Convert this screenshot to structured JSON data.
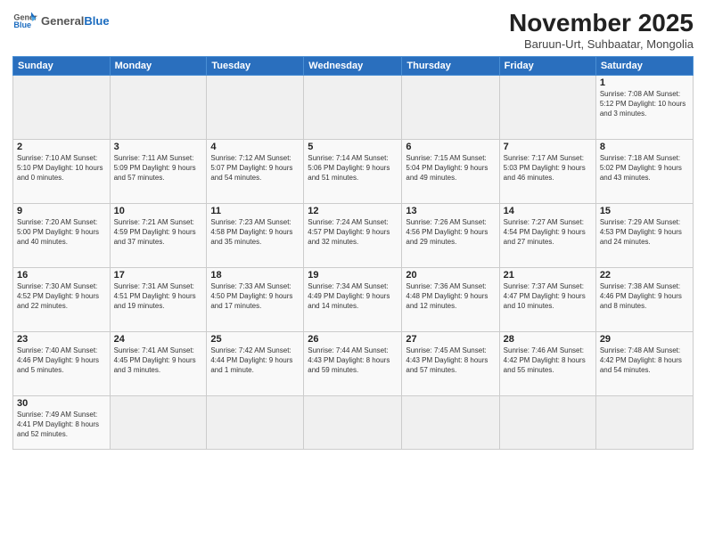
{
  "header": {
    "logo_general": "General",
    "logo_blue": "Blue",
    "month": "November 2025",
    "location": "Baruun-Urt, Suhbaatar, Mongolia"
  },
  "days_of_week": [
    "Sunday",
    "Monday",
    "Tuesday",
    "Wednesday",
    "Thursday",
    "Friday",
    "Saturday"
  ],
  "weeks": [
    [
      {
        "day": "",
        "info": ""
      },
      {
        "day": "",
        "info": ""
      },
      {
        "day": "",
        "info": ""
      },
      {
        "day": "",
        "info": ""
      },
      {
        "day": "",
        "info": ""
      },
      {
        "day": "",
        "info": ""
      },
      {
        "day": "1",
        "info": "Sunrise: 7:08 AM\nSunset: 5:12 PM\nDaylight: 10 hours and 3 minutes."
      }
    ],
    [
      {
        "day": "2",
        "info": "Sunrise: 7:10 AM\nSunset: 5:10 PM\nDaylight: 10 hours and 0 minutes."
      },
      {
        "day": "3",
        "info": "Sunrise: 7:11 AM\nSunset: 5:09 PM\nDaylight: 9 hours and 57 minutes."
      },
      {
        "day": "4",
        "info": "Sunrise: 7:12 AM\nSunset: 5:07 PM\nDaylight: 9 hours and 54 minutes."
      },
      {
        "day": "5",
        "info": "Sunrise: 7:14 AM\nSunset: 5:06 PM\nDaylight: 9 hours and 51 minutes."
      },
      {
        "day": "6",
        "info": "Sunrise: 7:15 AM\nSunset: 5:04 PM\nDaylight: 9 hours and 49 minutes."
      },
      {
        "day": "7",
        "info": "Sunrise: 7:17 AM\nSunset: 5:03 PM\nDaylight: 9 hours and 46 minutes."
      },
      {
        "day": "8",
        "info": "Sunrise: 7:18 AM\nSunset: 5:02 PM\nDaylight: 9 hours and 43 minutes."
      }
    ],
    [
      {
        "day": "9",
        "info": "Sunrise: 7:20 AM\nSunset: 5:00 PM\nDaylight: 9 hours and 40 minutes."
      },
      {
        "day": "10",
        "info": "Sunrise: 7:21 AM\nSunset: 4:59 PM\nDaylight: 9 hours and 37 minutes."
      },
      {
        "day": "11",
        "info": "Sunrise: 7:23 AM\nSunset: 4:58 PM\nDaylight: 9 hours and 35 minutes."
      },
      {
        "day": "12",
        "info": "Sunrise: 7:24 AM\nSunset: 4:57 PM\nDaylight: 9 hours and 32 minutes."
      },
      {
        "day": "13",
        "info": "Sunrise: 7:26 AM\nSunset: 4:56 PM\nDaylight: 9 hours and 29 minutes."
      },
      {
        "day": "14",
        "info": "Sunrise: 7:27 AM\nSunset: 4:54 PM\nDaylight: 9 hours and 27 minutes."
      },
      {
        "day": "15",
        "info": "Sunrise: 7:29 AM\nSunset: 4:53 PM\nDaylight: 9 hours and 24 minutes."
      }
    ],
    [
      {
        "day": "16",
        "info": "Sunrise: 7:30 AM\nSunset: 4:52 PM\nDaylight: 9 hours and 22 minutes."
      },
      {
        "day": "17",
        "info": "Sunrise: 7:31 AM\nSunset: 4:51 PM\nDaylight: 9 hours and 19 minutes."
      },
      {
        "day": "18",
        "info": "Sunrise: 7:33 AM\nSunset: 4:50 PM\nDaylight: 9 hours and 17 minutes."
      },
      {
        "day": "19",
        "info": "Sunrise: 7:34 AM\nSunset: 4:49 PM\nDaylight: 9 hours and 14 minutes."
      },
      {
        "day": "20",
        "info": "Sunrise: 7:36 AM\nSunset: 4:48 PM\nDaylight: 9 hours and 12 minutes."
      },
      {
        "day": "21",
        "info": "Sunrise: 7:37 AM\nSunset: 4:47 PM\nDaylight: 9 hours and 10 minutes."
      },
      {
        "day": "22",
        "info": "Sunrise: 7:38 AM\nSunset: 4:46 PM\nDaylight: 9 hours and 8 minutes."
      }
    ],
    [
      {
        "day": "23",
        "info": "Sunrise: 7:40 AM\nSunset: 4:46 PM\nDaylight: 9 hours and 5 minutes."
      },
      {
        "day": "24",
        "info": "Sunrise: 7:41 AM\nSunset: 4:45 PM\nDaylight: 9 hours and 3 minutes."
      },
      {
        "day": "25",
        "info": "Sunrise: 7:42 AM\nSunset: 4:44 PM\nDaylight: 9 hours and 1 minute."
      },
      {
        "day": "26",
        "info": "Sunrise: 7:44 AM\nSunset: 4:43 PM\nDaylight: 8 hours and 59 minutes."
      },
      {
        "day": "27",
        "info": "Sunrise: 7:45 AM\nSunset: 4:43 PM\nDaylight: 8 hours and 57 minutes."
      },
      {
        "day": "28",
        "info": "Sunrise: 7:46 AM\nSunset: 4:42 PM\nDaylight: 8 hours and 55 minutes."
      },
      {
        "day": "29",
        "info": "Sunrise: 7:48 AM\nSunset: 4:42 PM\nDaylight: 8 hours and 54 minutes."
      }
    ],
    [
      {
        "day": "30",
        "info": "Sunrise: 7:49 AM\nSunset: 4:41 PM\nDaylight: 8 hours and 52 minutes."
      },
      {
        "day": "",
        "info": ""
      },
      {
        "day": "",
        "info": ""
      },
      {
        "day": "",
        "info": ""
      },
      {
        "day": "",
        "info": ""
      },
      {
        "day": "",
        "info": ""
      },
      {
        "day": "",
        "info": ""
      }
    ]
  ]
}
